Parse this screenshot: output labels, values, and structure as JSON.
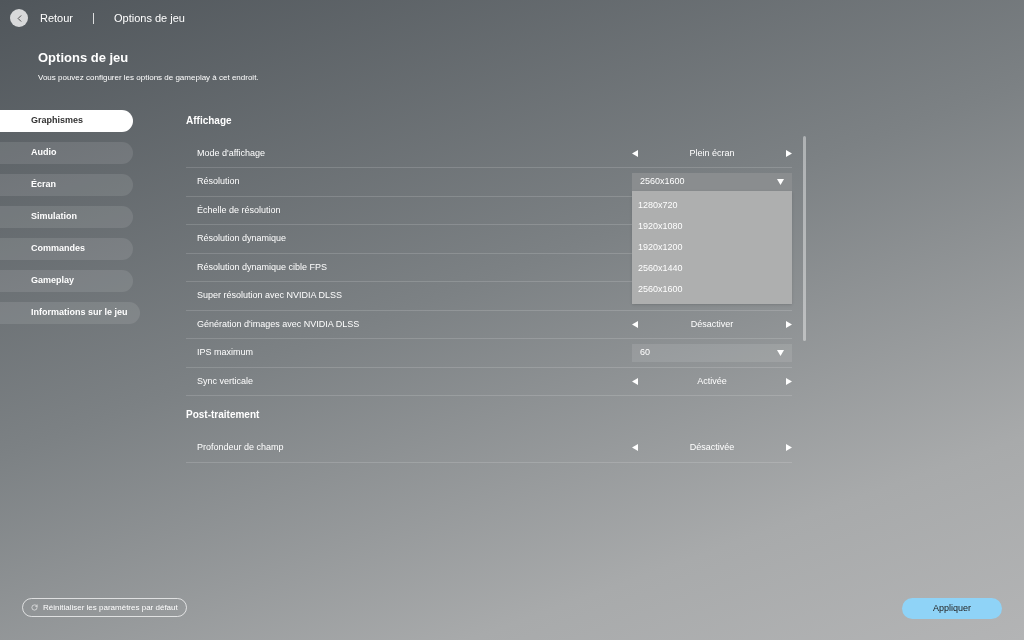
{
  "header": {
    "back": "Retour",
    "crumb": "Options de jeu"
  },
  "page": {
    "title": "Options de jeu",
    "subtitle": "Vous pouvez configurer les options de gameplay à cet endroit."
  },
  "sidebar": {
    "items": [
      {
        "label": "Graphismes",
        "selected": true
      },
      {
        "label": "Audio",
        "selected": false
      },
      {
        "label": "Écran",
        "selected": false
      },
      {
        "label": "Simulation",
        "selected": false
      },
      {
        "label": "Commandes",
        "selected": false
      },
      {
        "label": "Gameplay",
        "selected": false
      },
      {
        "label": "Informations sur le jeu",
        "selected": false
      }
    ]
  },
  "sections": [
    {
      "title": "Affichage",
      "rows": [
        {
          "label": "Mode d'affichage",
          "kind": "arrows",
          "value": "Plein écran"
        },
        {
          "label": "Résolution",
          "kind": "select",
          "value": "2560x1600",
          "expanded": true,
          "options": [
            "1280x720",
            "1920x1080",
            "1920x1200",
            "2560x1440",
            "2560x1600"
          ]
        },
        {
          "label": "Échelle de résolution",
          "kind": "covered"
        },
        {
          "label": "Résolution dynamique",
          "kind": "covered"
        },
        {
          "label": "Résolution dynamique cible FPS",
          "kind": "covered"
        },
        {
          "label": "Super résolution avec NVIDIA DLSS",
          "kind": "covered"
        },
        {
          "label": "Génération d'images avec NVIDIA DLSS",
          "kind": "arrows",
          "value": "Désactiver"
        },
        {
          "label": "IPS maximum",
          "kind": "select",
          "value": "60",
          "expanded": false
        },
        {
          "label": "Sync verticale",
          "kind": "arrows",
          "value": "Activée"
        }
      ]
    },
    {
      "title": "Post-traitement",
      "rows": [
        {
          "label": "Profondeur de champ",
          "kind": "arrows",
          "value": "Désactivée"
        }
      ]
    }
  ],
  "footer": {
    "reset": "Réinitialiser les paramètres par défaut",
    "apply": "Appliquer"
  }
}
